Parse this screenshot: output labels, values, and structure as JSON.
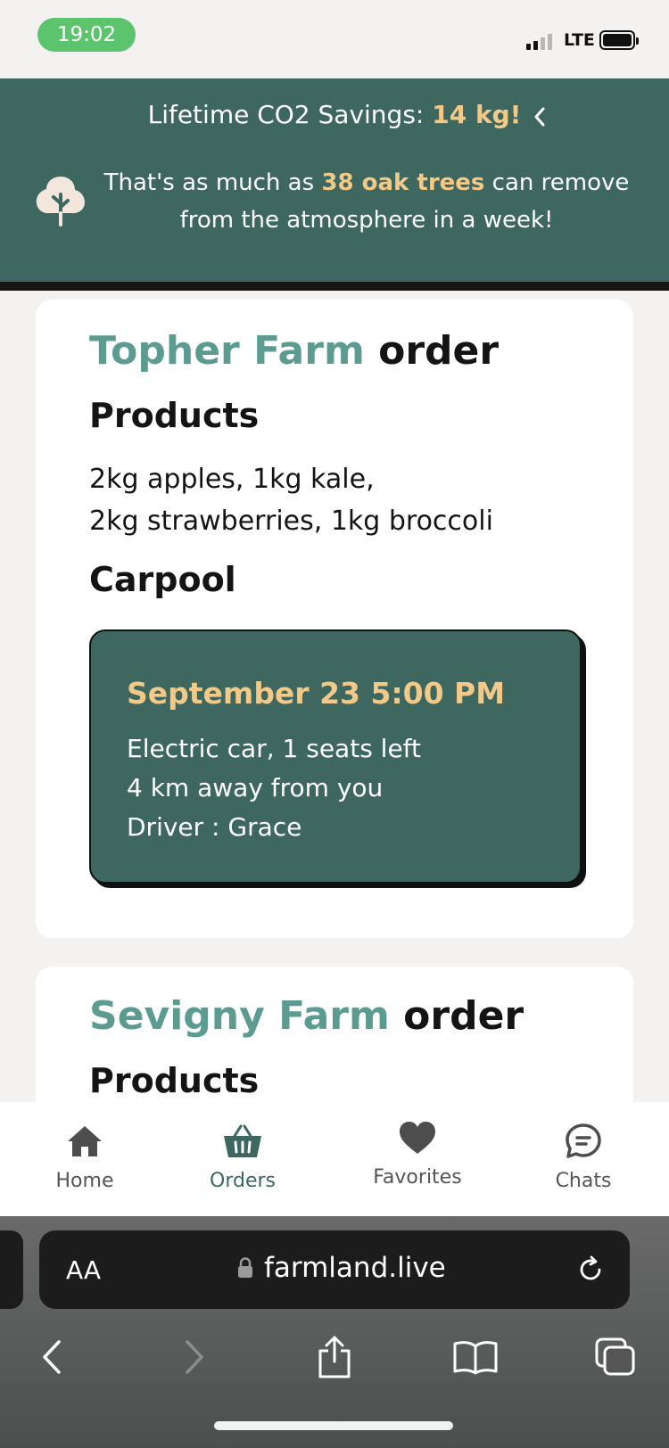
{
  "status_bar": {
    "time": "19:02",
    "network": "LTE"
  },
  "banner": {
    "savings_prefix": "Lifetime CO2 Savings: ",
    "savings_value": "14 kg!",
    "tree_prefix": "That's as much as ",
    "tree_value": "38 oak trees",
    "tree_suffix": " can remove",
    "tree_line2": "from the atmosphere in a week!",
    "highlight_color": "#f2c986",
    "background_color": "#3d675f"
  },
  "orders": [
    {
      "farm": "Topher Farm",
      "suffix": " order",
      "products_heading": "Products",
      "products_line1": "2kg apples,  1kg kale,",
      "products_line2": "2kg strawberries,  1kg broccoli",
      "carpool_heading": "Carpool",
      "carpool": {
        "datetime": "September 23 5:00 PM",
        "vehicle": "Electric car, 1 seats left",
        "distance": "4 km away from you",
        "driver": "Driver : Grace"
      }
    },
    {
      "farm": "Sevigny Farm",
      "suffix": " order",
      "products_heading": "Products"
    }
  ],
  "tabs": [
    {
      "label": "Home",
      "icon": "home-icon",
      "active": false
    },
    {
      "label": "Orders",
      "icon": "basket-icon",
      "active": true
    },
    {
      "label": "Favorites",
      "icon": "heart-icon",
      "active": false
    },
    {
      "label": "Chats",
      "icon": "chat-icon",
      "active": false
    }
  ],
  "browser": {
    "text_size_label": "AA",
    "domain": "farmland.live"
  }
}
